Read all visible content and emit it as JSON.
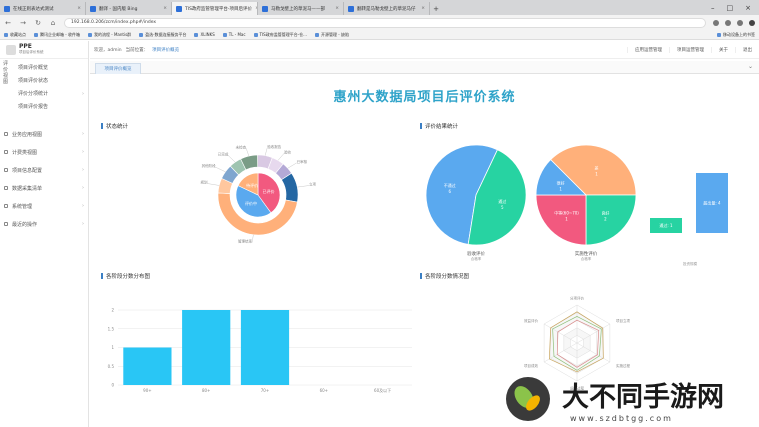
{
  "browser": {
    "tabs": [
      {
        "label": "在线正则表达式测试",
        "active": false
      },
      {
        "label": "翻译 - 国内版 Bing",
        "active": false
      },
      {
        "label": "TIS政府监管管理平台-项目后评价",
        "active": true
      },
      {
        "label": "马勒戈壁上的草泥马——部",
        "active": false
      },
      {
        "label": "翻转是马勒戈壁上的草泥马仔",
        "active": false
      }
    ],
    "url": "192.168.0.206/zcm/index.php#/index",
    "bookmarks": [
      "收藏站点",
      "腾讯企业邮箱 - 收件箱",
      "我的流程 - Mantis群",
      "盈选·数据连接服务平台",
      "XLINKS",
      "TL - Mac",
      "TIS政府监管管理平台-仓...",
      "开源管理 - 缺陷",
      "移动设备上的书签"
    ]
  },
  "app": {
    "logo_title": "PPE",
    "logo_sub": "项目后评价系统",
    "vertical_title": "评价视图",
    "submenu": [
      "项目评价概览",
      "项目评价状态",
      "评价分项统计",
      "项目评价报告"
    ],
    "menu": [
      "业务应用视图",
      "计费类视图",
      "项目信息配置",
      "数据采集清单",
      "系统管理",
      "最近的操作"
    ],
    "topbar": {
      "welcome": "欢迎，admin",
      "location_label": "当前位置：",
      "location": "项目评价概览",
      "links": [
        "应用运营管理",
        "项目运营管理",
        "关于",
        "退出"
      ]
    },
    "page_tab": "项目评价概览",
    "page_title": "惠州大数据局项目后评价系统"
  },
  "sections": {
    "status": "状态统计",
    "result": "评价结果统计",
    "score_dist": "各阶段分数分布图",
    "score_stage": "各阶段分数情况图"
  },
  "chart_data": [
    {
      "type": "pie",
      "title": "状态统计",
      "inner_labels": [
        "已评价",
        "评价中",
        "待评价"
      ],
      "outer_labels": [
        "未检查",
        "验收报告",
        "验收",
        "已审核",
        "立项",
        "管理结束",
        "规划",
        "其他阶段",
        "已完成"
      ]
    },
    {
      "type": "pie",
      "title": "验收评价",
      "caption": "验收评价",
      "caption_sub": "合格率",
      "labels": [
        "不通过",
        "通过"
      ],
      "values": [
        6,
        5
      ]
    },
    {
      "type": "pie",
      "title": "实施性评价",
      "caption": "实施性评价",
      "caption_sub": "合格率",
      "labels": [
        "差",
        "良好",
        "中等(60~70)",
        "很好"
      ],
      "values": [
        3,
        2,
        2,
        1
      ],
      "value_labels": [
        "1",
        "2",
        "1",
        "1"
      ]
    },
    {
      "type": "bar",
      "title": "投资规模",
      "categories": [
        "通过",
        "超出"
      ],
      "values": [
        1,
        4
      ],
      "value_labels": [
        "通过: 1",
        "超出量: 4"
      ]
    },
    {
      "type": "bar",
      "title": "各阶段分数分布图",
      "categories": [
        "90+",
        "80+",
        "70+",
        "60+",
        "60及以下"
      ],
      "values": [
        1,
        2,
        2,
        0,
        0
      ],
      "ylim": [
        0,
        2
      ],
      "yticks": [
        "0",
        "0.5",
        "1",
        "1.5",
        "2"
      ]
    },
    {
      "type": "radar",
      "title": "各阶段分数情况图",
      "axes": [
        "分项评价",
        "项目立项",
        "实施过程",
        "运行过程",
        "项目成效",
        "效益评价"
      ]
    }
  ],
  "watermark": {
    "text": "大不同手游网",
    "url": "www.szdbtgg.com"
  },
  "colors": {
    "accent": "#2ea3c9",
    "blue": "#5aa9ef",
    "green": "#27d3a2",
    "orange": "#ffb07a",
    "pink": "#f2597f",
    "bar": "#29c6f5"
  }
}
